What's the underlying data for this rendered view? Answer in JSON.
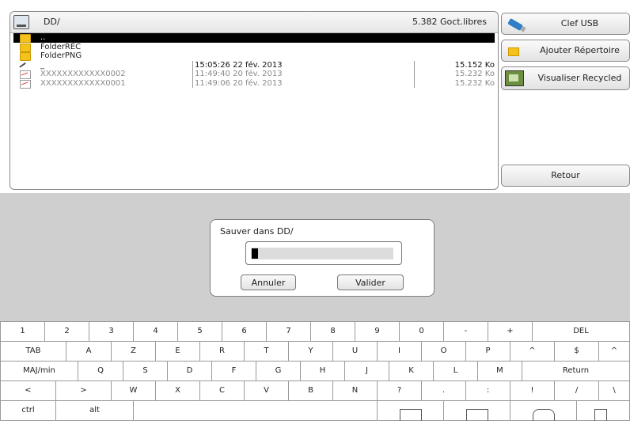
{
  "browser": {
    "path": "DD/",
    "free_space": "5.382 Goct.libres",
    "files": [
      {
        "name": "..",
        "date": "",
        "size": "",
        "icon": "folder-icon",
        "selected": true
      },
      {
        "name": "FolderREC",
        "date": "",
        "size": "",
        "icon": "folder-icon"
      },
      {
        "name": "FolderPNG",
        "date": "",
        "size": "",
        "icon": "folder-icon"
      },
      {
        "name": "_",
        "date": "15:05:26 22 fév. 2013",
        "size": "15.152 Ko",
        "icon": "tool-icon"
      },
      {
        "name": "XXXXXXXXXXXX0002",
        "date": "11:49:40 20 fév. 2013",
        "size": "15.232 Ko",
        "icon": "graph-file-icon"
      },
      {
        "name": "XXXXXXXXXXXX0001",
        "date": "11:49:06 20 fév. 2013",
        "size": "15.232 Ko",
        "icon": "graph-file-icon"
      }
    ]
  },
  "side_buttons": {
    "usb": "Clef USB",
    "add_dir": "Ajouter Répertoire",
    "view_recycled": "Visualiser Recycled",
    "back": "Retour"
  },
  "dialog": {
    "title": "Sauver dans DD/",
    "input_value": "",
    "cancel": "Annuler",
    "ok": "Valider"
  },
  "keyboard": {
    "row1": [
      "1",
      "2",
      "3",
      "4",
      "5",
      "6",
      "7",
      "8",
      "9",
      "0",
      "-",
      "+",
      "DEL"
    ],
    "row2": [
      "TAB",
      "A",
      "Z",
      "E",
      "R",
      "T",
      "Y",
      "U",
      "I",
      "O",
      "P",
      "^",
      "$",
      "^"
    ],
    "row3": [
      "MAJ/min",
      "Q",
      "S",
      "D",
      "F",
      "G",
      "H",
      "J",
      "K",
      "L",
      "M",
      "Return"
    ],
    "row4": [
      "<",
      ">",
      "W",
      "X",
      "C",
      "V",
      "B",
      "N",
      "?",
      ".",
      ":",
      "!",
      "/",
      "\\"
    ],
    "row5": [
      "ctrl",
      "alt"
    ]
  }
}
